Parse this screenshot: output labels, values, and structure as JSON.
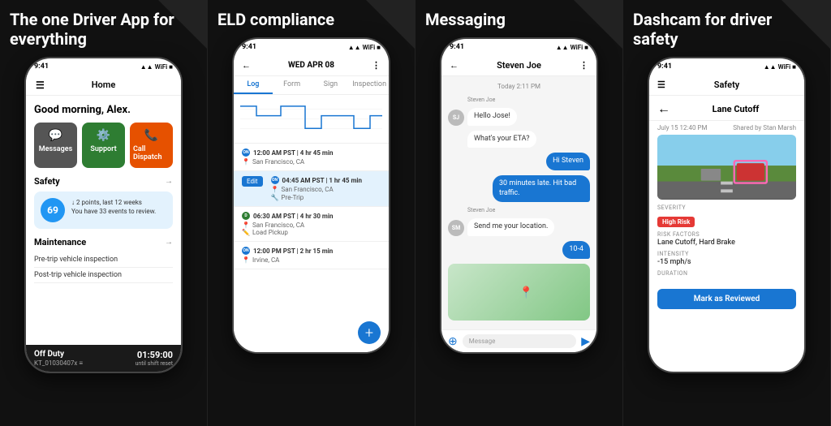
{
  "panels": [
    {
      "id": "home",
      "label": "The one Driver App for everything",
      "phone": {
        "status_time": "9:41",
        "nav_title": "Home",
        "greeting": "Good morning, Alex.",
        "buttons": [
          {
            "label": "Messages",
            "icon": "💬",
            "color": "grey"
          },
          {
            "label": "Support",
            "icon": "⚙️",
            "color": "green"
          },
          {
            "label": "Call Dispatch",
            "icon": "📞",
            "color": "orange"
          }
        ],
        "safety_section": "Safety",
        "safety_score": "69",
        "safety_note": "↓ 2 points, last 12 weeks",
        "safety_sub": "You have 33 events to review.",
        "maintenance_section": "Maintenance",
        "maintenance_items": [
          "Pre-trip vehicle inspection",
          "Post-trip vehicle inspection"
        ],
        "duty_status": "Off Duty",
        "duty_id": "KT_01030407x ≡",
        "duty_time": "01:59:00",
        "duty_until": "until shift reset"
      }
    },
    {
      "id": "eld",
      "label": "ELD compliance",
      "phone": {
        "status_time": "9:41",
        "nav_date": "WED APR 08",
        "tabs": [
          "Log",
          "Form",
          "Sign",
          "Inspection"
        ],
        "active_tab": "Log",
        "entries": [
          {
            "dot_color": "blue",
            "dot_label": "ON",
            "time": "12:00 AM PST | 4 hr 45 min",
            "location": "San Francisco, CA",
            "highlighted": false
          },
          {
            "dot_color": "blue",
            "dot_label": "ON",
            "time": "04:45 AM PST | 1 hr 45 min",
            "location": "San Francisco, CA",
            "sub": "Pre-Trip",
            "highlighted": true,
            "edit": true
          },
          {
            "dot_color": "green",
            "dot_label": "D",
            "time": "06:30 AM PST | 4 hr 30 min",
            "location": "San Francisco, CA",
            "sub": "Load Pickup",
            "highlighted": false
          },
          {
            "dot_color": "blue",
            "dot_label": "ON",
            "time": "12:00 PM PST | 2 hr 15 min",
            "location": "Irvine, CA",
            "highlighted": false
          }
        ],
        "fab_icon": "+"
      }
    },
    {
      "id": "messaging",
      "label": "Messaging",
      "phone": {
        "status_time": "9:41",
        "contact": "Steven Joe",
        "date_label": "Today 2:11 PM",
        "messages": [
          {
            "sender": "Steven Joe",
            "text": "Hello Jose!",
            "type": "received",
            "avatar": "SJ"
          },
          {
            "text": "What's your ETA?",
            "type": "received"
          },
          {
            "text": "Hi Steven",
            "type": "sent"
          },
          {
            "text": "30 minutes late. Hit bad traffic.",
            "type": "sent"
          },
          {
            "sender": "Steven Joe",
            "text": "Send me your location.",
            "type": "received",
            "avatar": "SM"
          },
          {
            "text": "10-4",
            "type": "sent"
          }
        ],
        "input_placeholder": "Message"
      }
    },
    {
      "id": "safety",
      "label": "Dashcam for driver safety",
      "phone": {
        "status_time": "9:41",
        "nav_title": "Safety",
        "incident_title": "Lane Cutoff",
        "incident_date": "July 15  12:40 PM",
        "incident_shared": "Shared by Stan Marsh",
        "severity_label": "SEVERITY",
        "severity_value": "High Risk",
        "risk_factors_label": "RISK FACTORS",
        "risk_factors_value": "Lane Cutoff, Hard Brake",
        "intensity_label": "INTENSITY",
        "intensity_value": "-15 mph/s",
        "duration_label": "DURATION",
        "btn_label": "Mark as Reviewed"
      }
    }
  ]
}
